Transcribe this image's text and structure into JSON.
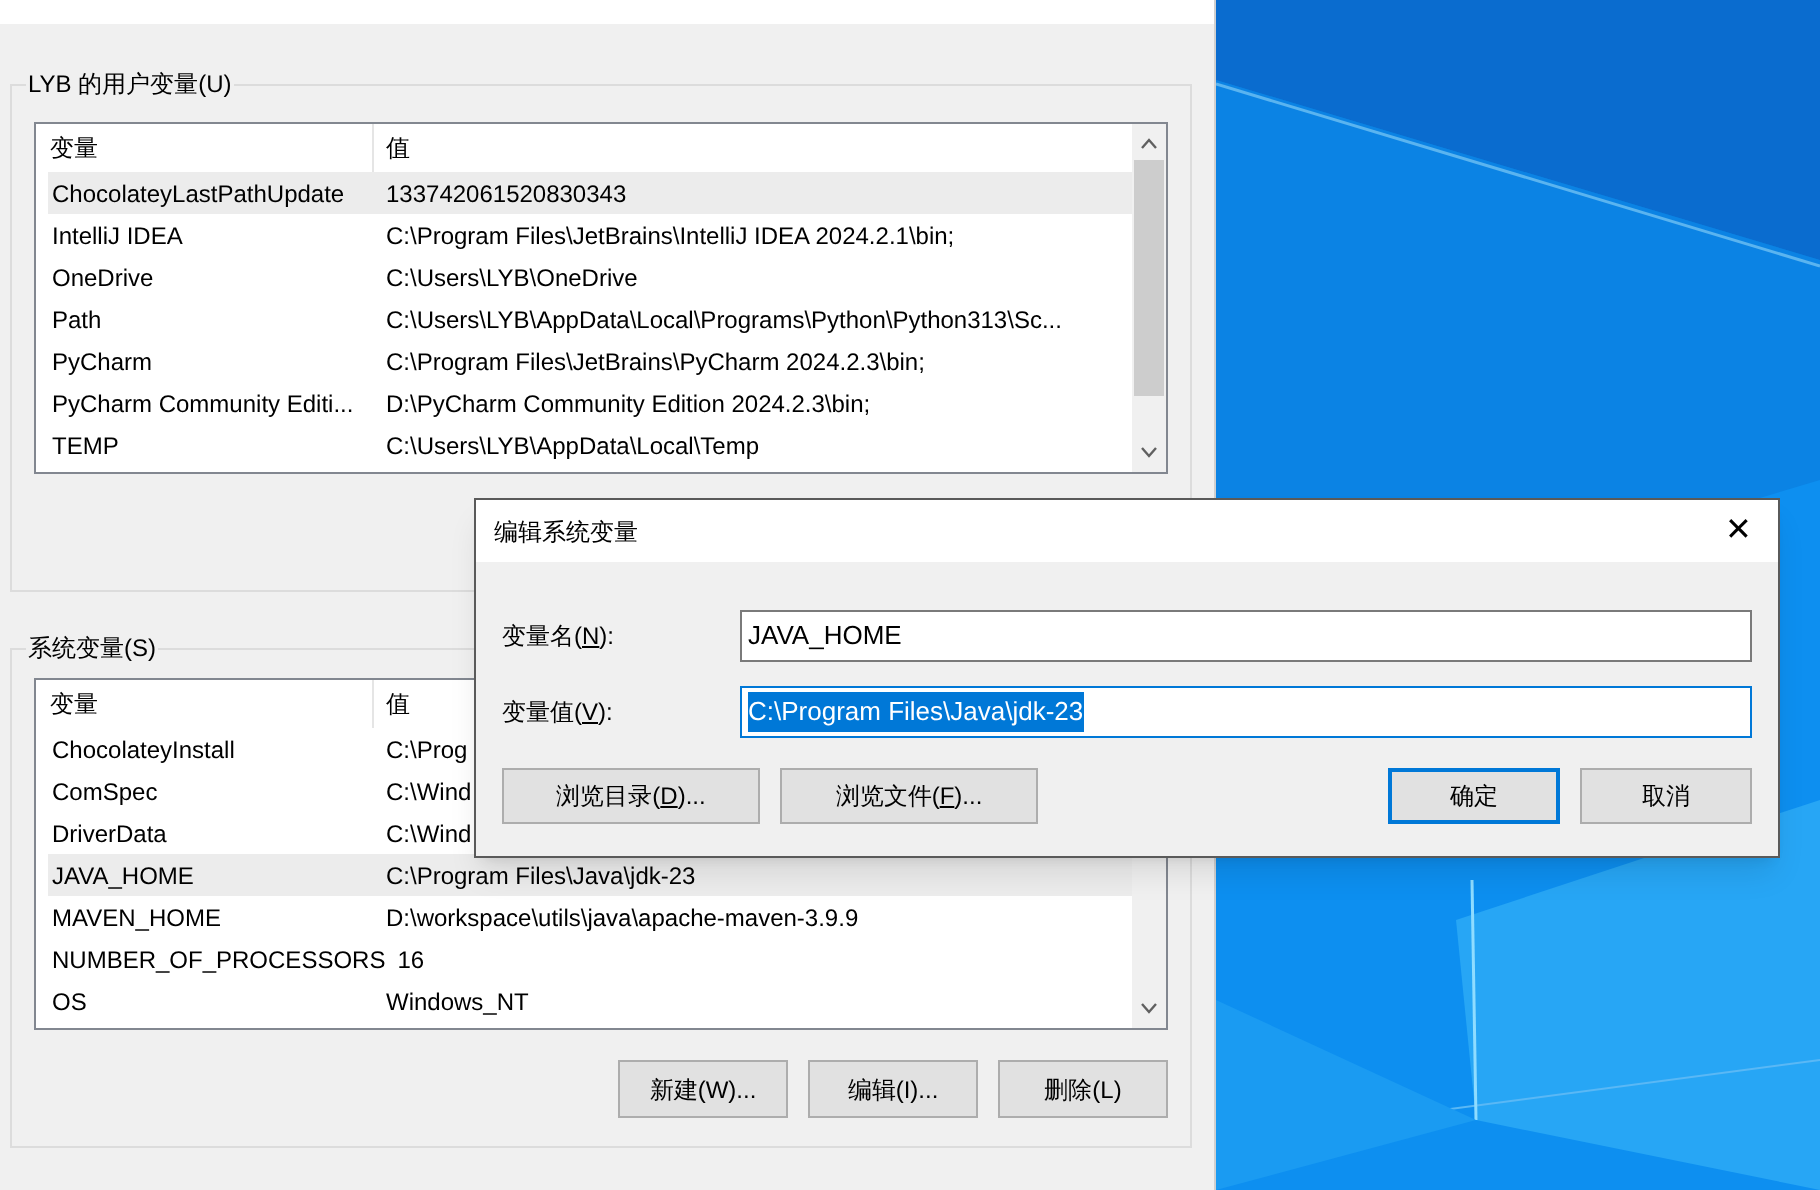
{
  "user_vars": {
    "title": "LYB 的用户变量(U)",
    "columns": [
      "变量",
      "值"
    ],
    "rows": [
      {
        "name": "ChocolateyLastPathUpdate",
        "value": "133742061520830343",
        "selected": true
      },
      {
        "name": "IntelliJ IDEA",
        "value": "C:\\Program Files\\JetBrains\\IntelliJ IDEA 2024.2.1\\bin;",
        "selected": false
      },
      {
        "name": "OneDrive",
        "value": "C:\\Users\\LYB\\OneDrive",
        "selected": false
      },
      {
        "name": "Path",
        "value": "C:\\Users\\LYB\\AppData\\Local\\Programs\\Python\\Python313\\Sc...",
        "selected": false
      },
      {
        "name": "PyCharm",
        "value": "C:\\Program Files\\JetBrains\\PyCharm 2024.2.3\\bin;",
        "selected": false
      },
      {
        "name": "PyCharm Community Editi...",
        "value": "D:\\PyCharm Community Edition 2024.2.3\\bin;",
        "selected": false
      },
      {
        "name": "TEMP",
        "value": "C:\\Users\\LYB\\AppData\\Local\\Temp",
        "selected": false
      }
    ]
  },
  "system_vars": {
    "title": "系统变量(S)",
    "columns": [
      "变量",
      "值"
    ],
    "rows": [
      {
        "name": "ChocolateyInstall",
        "value": "C:\\Prog",
        "selected": false
      },
      {
        "name": "ComSpec",
        "value": "C:\\Wind",
        "selected": false
      },
      {
        "name": "DriverData",
        "value": "C:\\Wind",
        "selected": false
      },
      {
        "name": "JAVA_HOME",
        "value": "C:\\Program Files\\Java\\jdk-23",
        "selected": true
      },
      {
        "name": "MAVEN_HOME",
        "value": "D:\\workspace\\utils\\java\\apache-maven-3.9.9",
        "selected": false
      },
      {
        "name": "NUMBER_OF_PROCESSORS",
        "value": "16",
        "selected": false
      },
      {
        "name": "OS",
        "value": "Windows_NT",
        "selected": false
      }
    ],
    "buttons": [
      "新建(W)...",
      "编辑(I)...",
      "删除(L)"
    ]
  },
  "dialog": {
    "title": "编辑系统变量",
    "close": "✕",
    "fields": [
      {
        "label_parts": [
          "变量名(",
          "N",
          "):"
        ],
        "value": "JAVA_HOME",
        "text_selected": false,
        "focused": false
      },
      {
        "label_parts": [
          "变量值(",
          "V",
          "):"
        ],
        "value": "C:\\Program Files\\Java\\jdk-23",
        "text_selected": true,
        "focused": true
      }
    ],
    "browse_buttons": [
      {
        "label_parts": [
          "浏览目录(",
          "D",
          ")..."
        ]
      },
      {
        "label_parts": [
          "浏览文件(",
          "F",
          ")..."
        ]
      }
    ],
    "action_buttons": [
      {
        "label": "确定",
        "default": true
      },
      {
        "label": "取消",
        "default": false
      }
    ]
  }
}
